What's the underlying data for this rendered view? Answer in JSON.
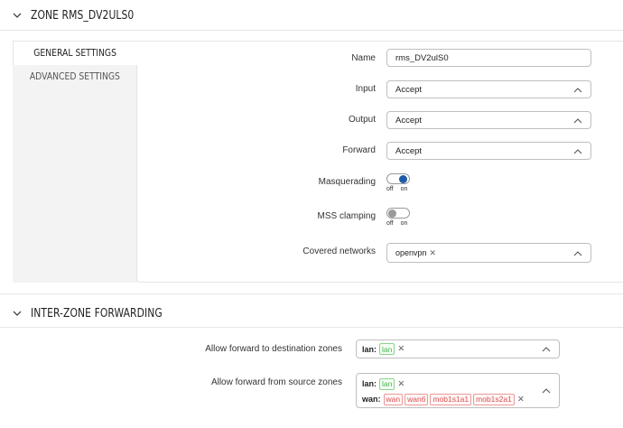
{
  "zone_section": {
    "title": "ZONE RMS_DV2ULS0",
    "tabs": [
      "GENERAL SETTINGS",
      "ADVANCED SETTINGS"
    ],
    "name": {
      "label": "Name",
      "value": "rms_DV2ulS0"
    },
    "input": {
      "label": "Input",
      "value": "Accept"
    },
    "output": {
      "label": "Output",
      "value": "Accept"
    },
    "forward": {
      "label": "Forward",
      "value": "Accept"
    },
    "masquerading": {
      "label": "Masquerading",
      "off": "off",
      "on": "on",
      "state": "on"
    },
    "mss_clamping": {
      "label": "MSS clamping",
      "off": "off",
      "on": "on",
      "state": "off"
    },
    "covered_networks": {
      "label": "Covered networks",
      "chips": [
        "openvpn"
      ]
    }
  },
  "forwarding_section": {
    "title": "INTER-ZONE FORWARDING",
    "dest": {
      "label": "Allow forward to destination zones",
      "zone": "lan:",
      "tags": [
        "lan"
      ]
    },
    "src": {
      "label": "Allow forward from source zones",
      "lan_zone": "lan:",
      "lan_tags": [
        "lan"
      ],
      "wan_zone": "wan:",
      "wan_tags": [
        "wan",
        "wan6",
        "mob1s1a1",
        "mob1s2a1"
      ]
    }
  },
  "colors": {
    "toggle_on": "#1f5aa8",
    "tag_green": "#4caf50",
    "tag_red": "#d9534f"
  },
  "icons": [
    "chevron-down-icon",
    "chevron-up-icon",
    "close-icon"
  ]
}
